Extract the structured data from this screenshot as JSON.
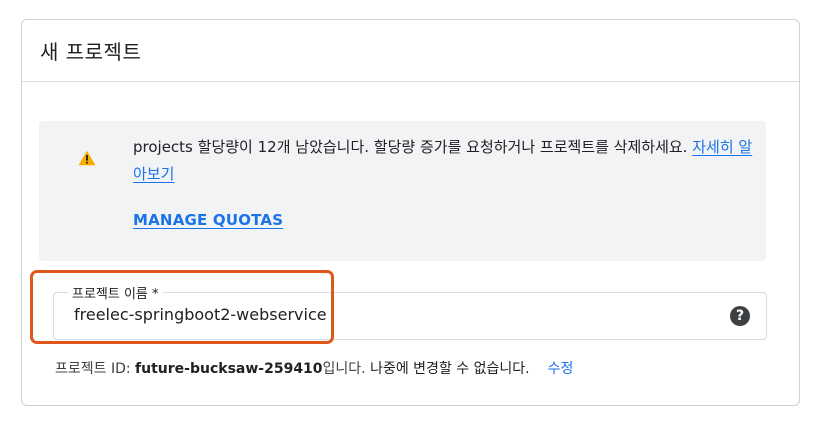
{
  "dialog": {
    "title": "새 프로젝트"
  },
  "banner": {
    "icon": "warning-icon",
    "message": "projects 할당량이 12개 남았습니다. 할당량 증가를 요청하거나 프로젝트를 삭제하세요.",
    "learn_more_label": "자세히 알아보기",
    "manage_quotas_label": "MANAGE QUOTAS"
  },
  "project_name_field": {
    "label": "프로젝트 이름 *",
    "value": "freelec-springboot2-webservice",
    "help_icon": "help-circle-icon"
  },
  "project_id": {
    "prefix": "프로젝트 ID: ",
    "value": "future-bucksaw-259410",
    "suffix": "입니다.",
    "notice": " 나중에 변경할 수 없습니다.",
    "edit_label": "수정"
  },
  "colors": {
    "accent": "#1a73e8",
    "highlight_border": "#e0571d",
    "warning": "#f9ab00",
    "banner_bg": "#f1f3f4"
  }
}
